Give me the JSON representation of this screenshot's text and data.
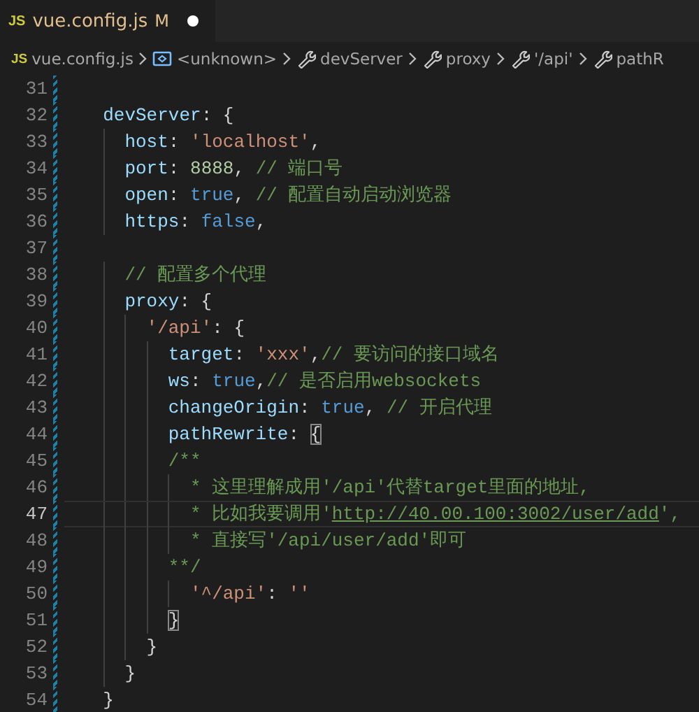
{
  "tab": {
    "file_icon": "JS",
    "label": "vue.config.js",
    "badge": "M",
    "modified": true
  },
  "breadcrumbs": [
    {
      "kind": "file",
      "icon_text": "JS",
      "label": "vue.config.js"
    },
    {
      "kind": "variable",
      "label": "<unknown>"
    },
    {
      "kind": "property",
      "label": "devServer"
    },
    {
      "kind": "property",
      "label": "proxy"
    },
    {
      "kind": "property",
      "label": "'/api'"
    },
    {
      "kind": "property",
      "label": "pathR"
    }
  ],
  "lines": [
    {
      "number": "31",
      "current": false,
      "modified": true
    },
    {
      "number": "32",
      "current": false,
      "modified": true,
      "tokens": [
        {
          "kind": "property",
          "text": "  devServer"
        },
        {
          "kind": "punct",
          "text": ": {"
        }
      ]
    },
    {
      "number": "33",
      "current": false,
      "modified": true,
      "tokens": [
        {
          "kind": "property",
          "text": "    host"
        },
        {
          "kind": "punct",
          "text": ": "
        },
        {
          "kind": "string",
          "text": "'localhost'"
        },
        {
          "kind": "punct",
          "text": ","
        }
      ]
    },
    {
      "number": "34",
      "current": false,
      "modified": true,
      "tokens": [
        {
          "kind": "property",
          "text": "    port"
        },
        {
          "kind": "punct",
          "text": ": "
        },
        {
          "kind": "number",
          "text": "8888"
        },
        {
          "kind": "punct",
          "text": ", "
        },
        {
          "kind": "comment",
          "text": "// 端口号"
        }
      ]
    },
    {
      "number": "35",
      "current": false,
      "modified": true,
      "tokens": [
        {
          "kind": "property",
          "text": "    open"
        },
        {
          "kind": "punct",
          "text": ": "
        },
        {
          "kind": "keyword",
          "text": "true"
        },
        {
          "kind": "punct",
          "text": ", "
        },
        {
          "kind": "comment",
          "text": "// 配置自动启动浏览器"
        }
      ]
    },
    {
      "number": "36",
      "current": false,
      "modified": true,
      "tokens": [
        {
          "kind": "property",
          "text": "    https"
        },
        {
          "kind": "punct",
          "text": ": "
        },
        {
          "kind": "keyword",
          "text": "false"
        },
        {
          "kind": "punct",
          "text": ","
        }
      ]
    },
    {
      "number": "37",
      "current": false,
      "modified": true
    },
    {
      "number": "38",
      "current": false,
      "modified": true,
      "tokens": [
        {
          "kind": "comment",
          "text": "    // 配置多个代理"
        }
      ]
    },
    {
      "number": "39",
      "current": false,
      "modified": true,
      "tokens": [
        {
          "kind": "property",
          "text": "    proxy"
        },
        {
          "kind": "punct",
          "text": ": {"
        }
      ]
    },
    {
      "number": "40",
      "current": false,
      "modified": true,
      "tokens": [
        {
          "kind": "string",
          "text": "      '/api'"
        },
        {
          "kind": "punct",
          "text": ": {"
        }
      ]
    },
    {
      "number": "41",
      "current": false,
      "modified": true,
      "tokens": [
        {
          "kind": "property",
          "text": "        target"
        },
        {
          "kind": "punct",
          "text": ": "
        },
        {
          "kind": "string",
          "text": "'xxx'"
        },
        {
          "kind": "punct",
          "text": ","
        },
        {
          "kind": "comment",
          "text": "// 要访问的接口域名"
        }
      ]
    },
    {
      "number": "42",
      "current": false,
      "modified": true,
      "tokens": [
        {
          "kind": "property",
          "text": "        ws"
        },
        {
          "kind": "punct",
          "text": ": "
        },
        {
          "kind": "keyword",
          "text": "true"
        },
        {
          "kind": "punct",
          "text": ","
        },
        {
          "kind": "comment",
          "text": "// 是否启用websockets"
        }
      ]
    },
    {
      "number": "43",
      "current": false,
      "modified": true,
      "tokens": [
        {
          "kind": "property",
          "text": "        changeOrigin"
        },
        {
          "kind": "punct",
          "text": ": "
        },
        {
          "kind": "keyword",
          "text": "true"
        },
        {
          "kind": "punct",
          "text": ", "
        },
        {
          "kind": "comment",
          "text": "// 开启代理"
        }
      ]
    },
    {
      "number": "44",
      "current": false,
      "modified": true,
      "tokens": [
        {
          "kind": "property",
          "text": "        pathRewrite"
        },
        {
          "kind": "punct",
          "text": ": "
        },
        {
          "kind": "bracket-match",
          "text": "{"
        }
      ]
    },
    {
      "number": "45",
      "current": false,
      "modified": true,
      "tokens": [
        {
          "kind": "comment",
          "text": "        /**"
        }
      ]
    },
    {
      "number": "46",
      "current": false,
      "modified": true,
      "tokens": [
        {
          "kind": "comment",
          "text": "          * 这里理解成用'/api'代替target里面的地址,"
        }
      ]
    },
    {
      "number": "47",
      "current": true,
      "modified": true,
      "tokens": [
        {
          "kind": "comment",
          "text": "          * 比如我要调用'"
        },
        {
          "kind": "link",
          "text": "http://40.00.100:3002/user/add"
        },
        {
          "kind": "comment",
          "text": "',"
        }
      ]
    },
    {
      "number": "48",
      "current": false,
      "modified": true,
      "tokens": [
        {
          "kind": "comment",
          "text": "          * 直接写'/api/user/add'即可"
        }
      ]
    },
    {
      "number": "49",
      "current": false,
      "modified": true,
      "tokens": [
        {
          "kind": "comment",
          "text": "        **/"
        }
      ]
    },
    {
      "number": "50",
      "current": false,
      "modified": true,
      "tokens": [
        {
          "kind": "string",
          "text": "          '^/api'"
        },
        {
          "kind": "punct",
          "text": ": "
        },
        {
          "kind": "string",
          "text": "''"
        }
      ]
    },
    {
      "number": "51",
      "current": false,
      "modified": true,
      "tokens": [
        {
          "kind": "bracket-match",
          "text": "        }"
        }
      ]
    },
    {
      "number": "52",
      "current": false,
      "modified": true,
      "tokens": [
        {
          "kind": "punct",
          "text": "      }"
        }
      ]
    },
    {
      "number": "53",
      "current": false,
      "modified": true,
      "tokens": [
        {
          "kind": "punct",
          "text": "    }"
        }
      ]
    },
    {
      "number": "54",
      "current": false,
      "modified": true,
      "tokens": [
        {
          "kind": "punct",
          "text": "  }"
        }
      ]
    }
  ]
}
